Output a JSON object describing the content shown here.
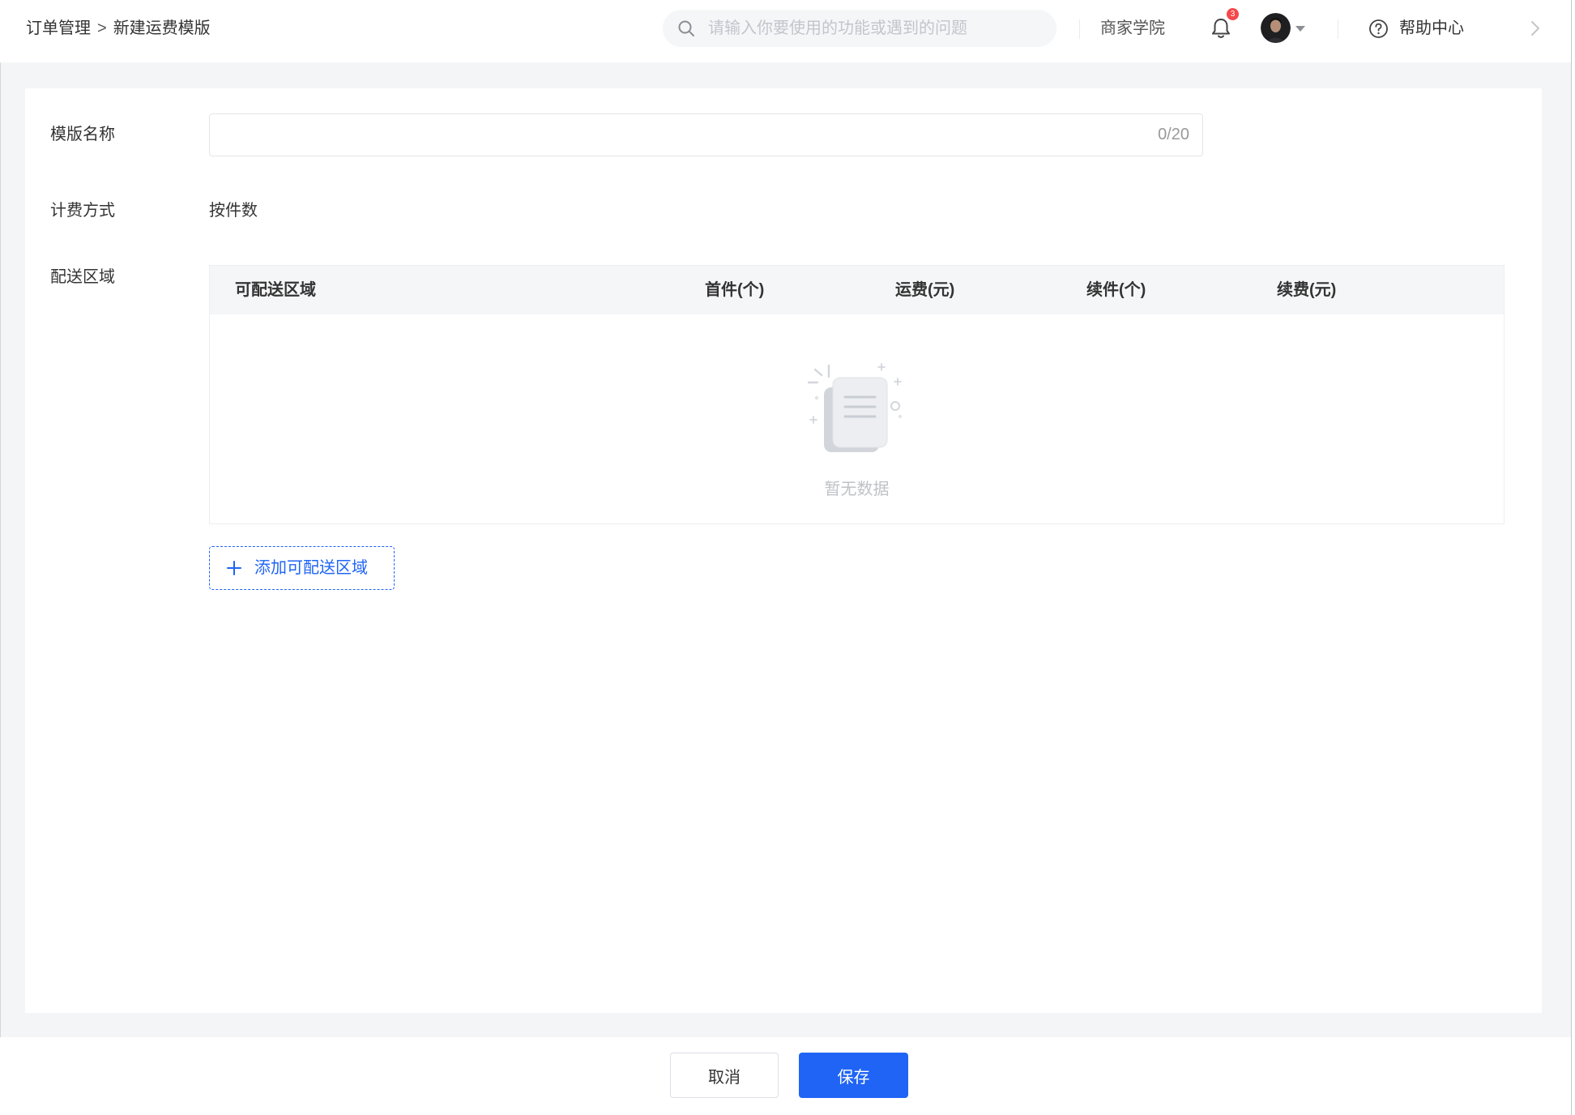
{
  "header": {
    "breadcrumb": {
      "parent": "订单管理",
      "separator": ">",
      "current": "新建运费模版"
    },
    "search": {
      "placeholder": "请输入你要使用的功能或遇到的问题",
      "value": ""
    },
    "academy_label": "商家学院",
    "notification_count": "3",
    "help_label": "帮助中心"
  },
  "form": {
    "name": {
      "label": "模版名称",
      "value": "",
      "counter": "0/20"
    },
    "billing": {
      "label": "计费方式",
      "value": "按件数"
    },
    "delivery": {
      "label": "配送区域",
      "columns": [
        "可配送区域",
        "首件(个)",
        "运费(元)",
        "续件(个)",
        "续费(元)"
      ],
      "rows": [],
      "empty_text": "暂无数据",
      "add_label": "添加可配送区域"
    }
  },
  "footer": {
    "cancel_label": "取消",
    "save_label": "保存"
  },
  "icons": [
    "search-icon",
    "bell-icon",
    "avatar",
    "caret-down-icon",
    "help-icon",
    "chevron-right-icon",
    "empty-document-icon",
    "plus-icon"
  ],
  "colors": {
    "accent": "#1f64f5",
    "badge": "#f5484a",
    "page_background": "#f4f5f7",
    "table_header_background": "#f5f6f7"
  }
}
